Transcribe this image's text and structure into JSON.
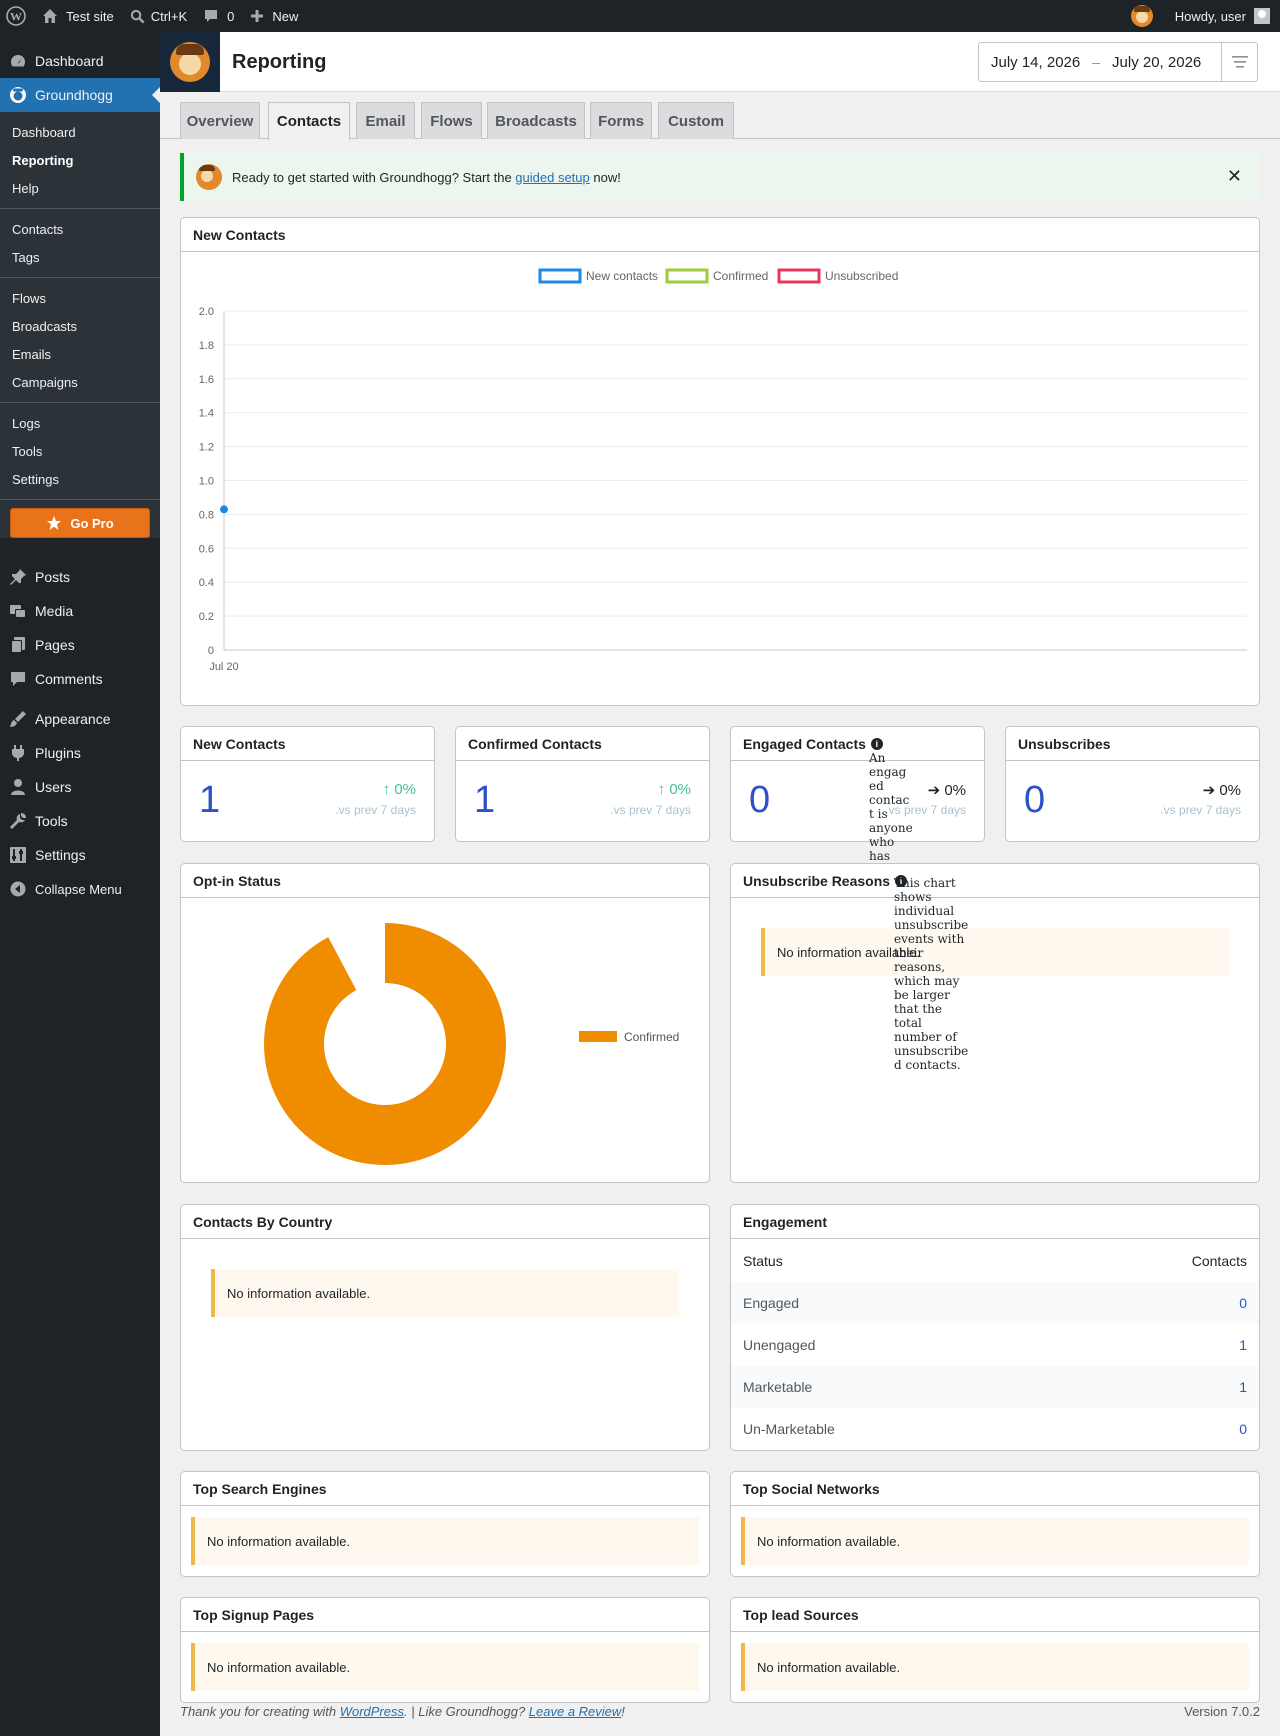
{
  "adminbar": {
    "site_name": "Test site",
    "search_shortcut": "Ctrl+K",
    "comments_count": "0",
    "new_label": "New",
    "howdy": "Howdy, user"
  },
  "sidebar": {
    "top": [
      {
        "label": "Dashboard",
        "icon": "dashboard-icon"
      },
      {
        "label": "Groundhogg",
        "icon": "groundhogg-icon"
      }
    ],
    "submenu": [
      "Dashboard",
      "Reporting",
      "Help",
      "Contacts",
      "Tags",
      "Flows",
      "Broadcasts",
      "Emails",
      "Campaigns",
      "Logs",
      "Tools",
      "Settings"
    ],
    "go_pro": "Go Pro",
    "bottom": [
      {
        "label": "Posts",
        "icon": "pushpin-icon"
      },
      {
        "label": "Media",
        "icon": "media-icon"
      },
      {
        "label": "Pages",
        "icon": "pages-icon"
      },
      {
        "label": "Comments",
        "icon": "comment-icon"
      },
      {
        "label": "Appearance",
        "icon": "paintbrush-icon"
      },
      {
        "label": "Plugins",
        "icon": "plugin-icon"
      },
      {
        "label": "Users",
        "icon": "users-icon"
      },
      {
        "label": "Tools",
        "icon": "wrench-icon"
      },
      {
        "label": "Settings",
        "icon": "settings-icon"
      },
      {
        "label": "Collapse Menu",
        "icon": "collapse-icon"
      }
    ]
  },
  "header": {
    "title": "Reporting",
    "date_start": "July 14, 2026",
    "date_sep": "–",
    "date_end": "July 20, 2026"
  },
  "tabs": [
    "Overview",
    "Contacts",
    "Email",
    "Flows",
    "Broadcasts",
    "Forms",
    "Custom"
  ],
  "active_tab": "Contacts",
  "notice": {
    "before": "Ready to get started with Groundhogg? Start the ",
    "link": "guided setup",
    "after": " now!",
    "close": "✕"
  },
  "new_contacts_chart": {
    "title": "New Contacts",
    "legend": [
      {
        "label": "New contacts",
        "color": "#1e88e5"
      },
      {
        "label": "Confirmed",
        "color": "#9ccc3d"
      },
      {
        "label": "Unsubscribed",
        "color": "#e53958"
      }
    ],
    "y_ticks": [
      "2.0",
      "1.8",
      "1.6",
      "1.4",
      "1.2",
      "1.0",
      "0.8",
      "0.6",
      "0.4",
      "0.2",
      "0"
    ]
  },
  "chart_data": {
    "type": "line",
    "title": "New Contacts",
    "x": [
      "Jul 20"
    ],
    "series": [
      {
        "name": "New contacts",
        "values": [
          0.83
        ]
      },
      {
        "name": "Confirmed",
        "values": []
      },
      {
        "name": "Unsubscribed",
        "values": []
      }
    ],
    "ylim": [
      0,
      2.0
    ],
    "grid": true,
    "legend": "top-center"
  },
  "stats": [
    {
      "title": "New Contacts",
      "value": "1",
      "pct": "0%",
      "dir": "up",
      "prev": ".vs prev 7 days"
    },
    {
      "title": "Confirmed Contacts",
      "value": "1",
      "pct": "0%",
      "dir": "up",
      "prev": ".vs prev 7 days"
    },
    {
      "title": "Engaged Contacts",
      "value": "0",
      "pct": "0%",
      "dir": "flat",
      "prev": ".vs prev 7 days"
    },
    {
      "title": "Unsubscribes",
      "value": "0",
      "pct": "0%",
      "dir": "flat",
      "prev": ".vs prev 7 days"
    }
  ],
  "engaged_tooltip": "An engaged contact is anyone who has any",
  "optin": {
    "title": "Opt-in Status",
    "legend": "Confirmed",
    "color": "#f08c00",
    "slices": [
      {
        "label": "Confirmed",
        "value": 1
      }
    ]
  },
  "unsub_reasons": {
    "title": "Unsubscribe Reasons",
    "nodata": "No information available.",
    "tooltip": "This chart shows individual unsubscribe events with their reasons, which may be larger that the total number of unsubscribed contacts."
  },
  "country": {
    "title": "Contacts By Country",
    "nodata": "No information available."
  },
  "engagement": {
    "title": "Engagement",
    "col_status": "Status",
    "col_contacts": "Contacts",
    "rows": [
      {
        "k": "Engaged",
        "v": "0"
      },
      {
        "k": "Unengaged",
        "v": "1"
      },
      {
        "k": "Marketable",
        "v": "1"
      },
      {
        "k": "Un-Marketable",
        "v": "0"
      }
    ]
  },
  "search_engines": {
    "title": "Top Search Engines",
    "nodata": "No information available."
  },
  "social": {
    "title": "Top Social Networks",
    "nodata": "No information available."
  },
  "signup": {
    "title": "Top Signup Pages",
    "nodata": "No information available."
  },
  "lead": {
    "title": "Top lead Sources",
    "nodata": "No information available."
  },
  "footer": {
    "p1": "Thank you for creating with ",
    "wp": "WordPress",
    "p2": ". | Like Groundhogg? ",
    "review": "Leave a Review",
    "p3": "!",
    "version": "Version 7.0.2"
  }
}
